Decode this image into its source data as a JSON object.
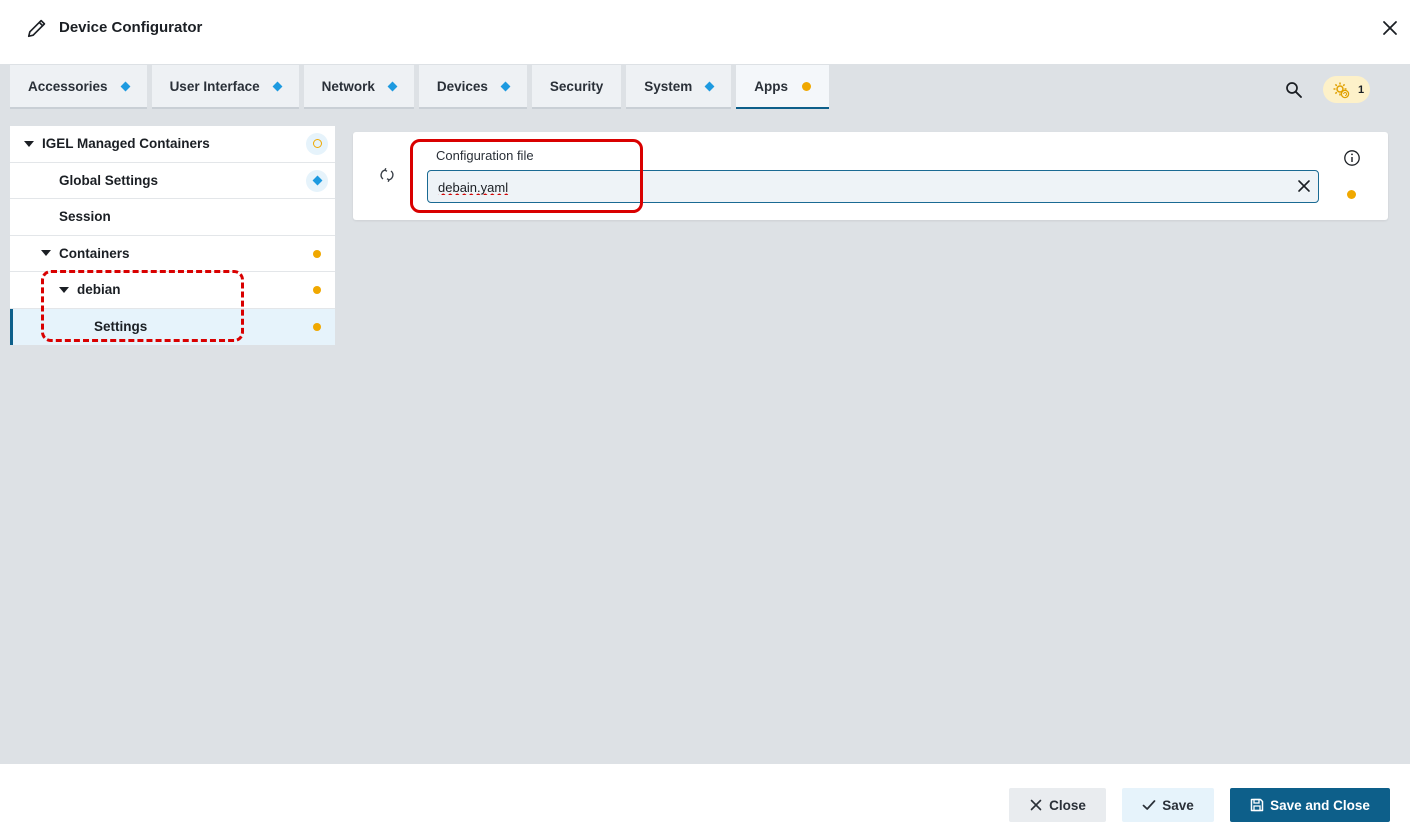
{
  "header": {
    "title": "Device Configurator"
  },
  "tabs": [
    {
      "label": "Accessories",
      "indicator": "diamond"
    },
    {
      "label": "User Interface",
      "indicator": "diamond"
    },
    {
      "label": "Network",
      "indicator": "diamond"
    },
    {
      "label": "Devices",
      "indicator": "diamond"
    },
    {
      "label": "Security",
      "indicator": "none"
    },
    {
      "label": "System",
      "indicator": "diamond"
    },
    {
      "label": "Apps",
      "indicator": "dot",
      "active": true
    }
  ],
  "badge": {
    "count": "1"
  },
  "tree": {
    "items": [
      {
        "label": "IGEL Managed Containers",
        "level": 0,
        "expanded": true,
        "marker": "ring"
      },
      {
        "label": "Global Settings",
        "level": 1,
        "marker": "diamond"
      },
      {
        "label": "Session",
        "level": 1,
        "marker": "none"
      },
      {
        "label": "Containers",
        "level": 1,
        "expanded": true,
        "marker": "dot"
      },
      {
        "label": "debian",
        "level": 2,
        "expanded": true,
        "marker": "dot"
      },
      {
        "label": "Settings",
        "level": 3,
        "marker": "dot",
        "selected": true
      }
    ]
  },
  "config": {
    "field_label": "Configuration file",
    "field_value": "debain.yaml"
  },
  "footer": {
    "close_label": "Close",
    "save_label": "Save",
    "save_close_label": "Save and Close"
  },
  "colors": {
    "accent": "#0d5f8a",
    "modified_dot": "#f0a800",
    "diamond": "#1d9ae0",
    "highlight_red": "#d90000"
  }
}
